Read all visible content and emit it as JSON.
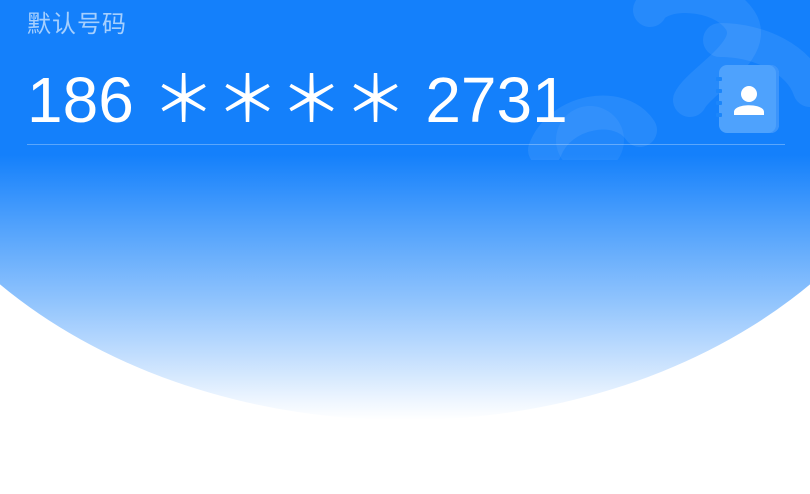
{
  "section": {
    "label": "默认号码",
    "phone": "186 ＊＊＊＊ 2731"
  },
  "icons": {
    "contact_button": "contact-book-icon",
    "watermark": "brand-watermark-icon"
  },
  "colors": {
    "hero_blue": "#1480fb",
    "button_bg": "#4ea2fd",
    "text": "#ffffff"
  }
}
